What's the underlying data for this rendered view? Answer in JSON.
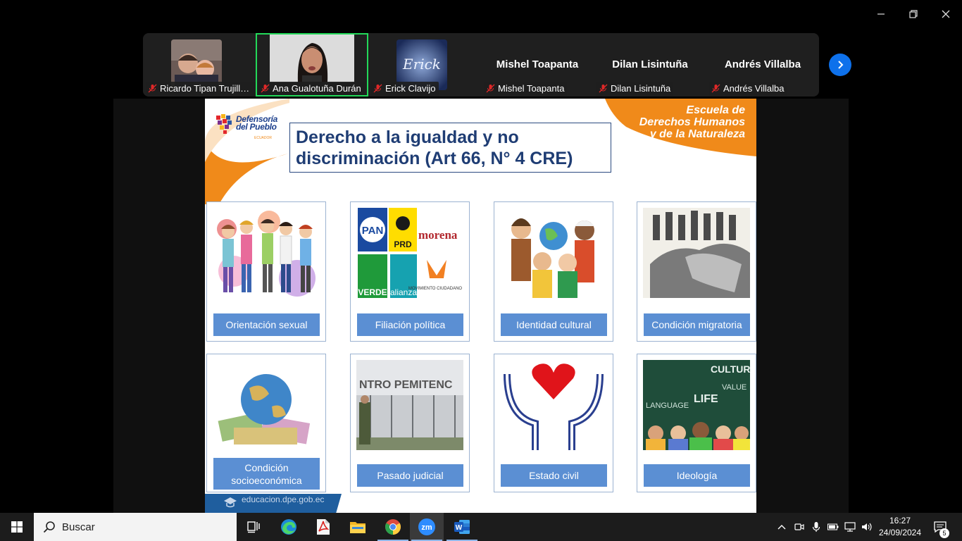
{
  "window": {
    "minimize_icon": "minimize-icon",
    "restore_icon": "restore-icon",
    "close_icon": "close-icon"
  },
  "participants": [
    {
      "name": "Ricardo Tipan Trujillo...",
      "muted": true,
      "has_video": true
    },
    {
      "name": "Ana Gualotuña Durán",
      "muted": true,
      "has_video": true,
      "active_speaker": true
    },
    {
      "name": "Erick Clavijo",
      "muted": true,
      "has_video": true
    },
    {
      "name": "Mishel Toapanta",
      "display_name": "Mishel Toapanta",
      "muted": true,
      "has_video": false
    },
    {
      "name": "Dilan Lisintuña",
      "display_name": "Dilan Lisintuña",
      "muted": true,
      "has_video": false
    },
    {
      "name": "Andrés Villalba",
      "display_name": "Andrés Villalba",
      "muted": true,
      "has_video": false
    }
  ],
  "avatar_text": {
    "erick": "Erick"
  },
  "slide": {
    "logo_line1": "Defensoría",
    "logo_line2": "del Pueblo",
    "logo_country": "ECUADOR",
    "school_line1": "Escuela de",
    "school_line2": "Derechos Humanos",
    "school_line3": "y de la Naturaleza",
    "title_line1": "Derecho a la igualdad y no",
    "title_line2": "discriminación (Art 66, N° 4 CRE)",
    "cards": [
      {
        "caption": "Orientación sexual"
      },
      {
        "caption": "Filiación política"
      },
      {
        "caption": "Identidad cultural"
      },
      {
        "caption": "Condición migratoria"
      },
      {
        "caption_line1": "Condición",
        "caption_line2": "socioeconómica"
      },
      {
        "caption": "Pasado judicial"
      },
      {
        "caption": "Estado civil"
      },
      {
        "caption": "Ideología"
      }
    ],
    "party_labels": {
      "pan": "PAN",
      "prd": "PRD",
      "morena": "morena",
      "verde": "VERDE",
      "alianza": "alianza",
      "mc": "MOVIMIENTO CIUDADANO"
    },
    "prison_text": "NTRO PEMITENC",
    "ideology_words": {
      "w1": "CULTURE",
      "w2": "VALUE",
      "w3": "LIFE",
      "w4": "LANGUAGE"
    },
    "footer_url": "educacion.dpe.gob.ec"
  },
  "taskbar": {
    "search_placeholder": "Buscar",
    "time": "16:27",
    "date": "24/09/2024",
    "notification_count": "5",
    "apps": [
      "task-view",
      "edge",
      "acrobat",
      "file-explorer",
      "chrome",
      "zoom",
      "word"
    ]
  },
  "colors": {
    "zoom_blue": "#0e71eb",
    "active_speaker": "#23d959",
    "slide_orange": "#f08a1a",
    "caption_blue": "#5b8fd3",
    "title_navy": "#1f3d74"
  }
}
